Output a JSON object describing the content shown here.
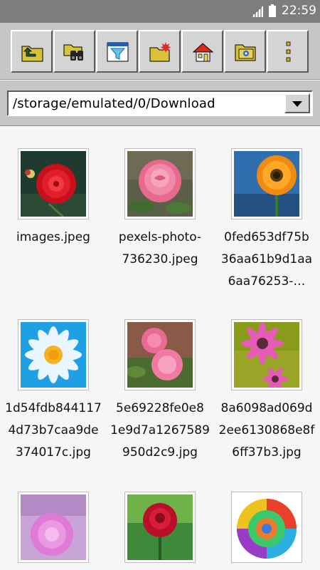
{
  "status_bar": {
    "time": "22:59"
  },
  "toolbar": {
    "buttons": [
      {
        "icon": "folder-up-icon"
      },
      {
        "icon": "binoculars-search-icon"
      },
      {
        "icon": "filter-icon"
      },
      {
        "icon": "new-folder-icon"
      },
      {
        "icon": "home-icon"
      },
      {
        "icon": "folder-settings-icon"
      },
      {
        "icon": "more-vert-icon"
      }
    ]
  },
  "path_bar": {
    "value": "/storage/emulated/0/Download"
  },
  "files": [
    {
      "name": "images.jpeg",
      "thumbnail": "red-dahlia"
    },
    {
      "name": "pexels-photo-\n736230.jpeg",
      "thumbnail": "pink-rose"
    },
    {
      "name": "0fed653df75b\n36aa61b9d1aa\n6aa76253-…",
      "thumbnail": "orange-gerbera"
    },
    {
      "name": "1d54fdb844117\n4d73b7caa9de\n374017c.jpg",
      "thumbnail": "white-daisy-blue"
    },
    {
      "name": "5e69228fe0e8\n1e9d7a1267589\n950d2c9.jpg",
      "thumbnail": "pink-roses"
    },
    {
      "name": "8a6098ad069d\n2ee6130868e8f\n6ff37b3.jpg",
      "thumbnail": "pink-daisies"
    },
    {
      "name": "",
      "thumbnail": "lilac-rose"
    },
    {
      "name": "",
      "thumbnail": "red-rose"
    },
    {
      "name": "",
      "thumbnail": "rainbow-rose"
    }
  ]
}
